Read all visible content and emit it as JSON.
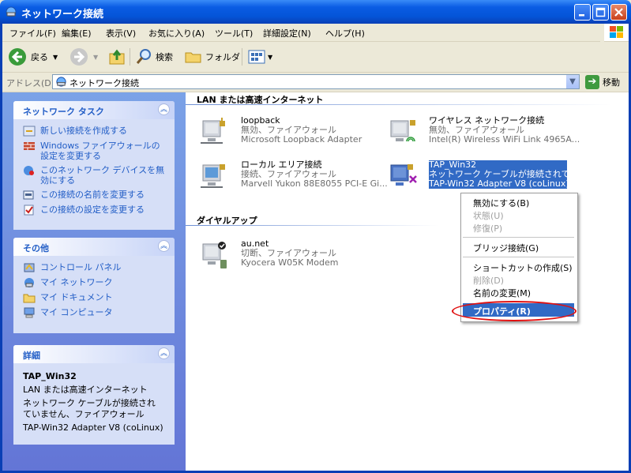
{
  "window": {
    "title": "ネットワーク接続"
  },
  "menu": [
    "ファイル(F)",
    "編集(E)",
    "表示(V)",
    "お気に入り(A)",
    "ツール(T)",
    "詳細設定(N)",
    "ヘルプ(H)"
  ],
  "toolbar": {
    "back": "戻る",
    "search": "検索",
    "folders": "フォルダ"
  },
  "address": {
    "label": "アドレス(D)",
    "value": "ネットワーク接続",
    "go": "移動"
  },
  "tasks": {
    "title": "ネットワーク タスク",
    "items": [
      "新しい接続を作成する",
      "Windows ファイアウォールの設定を変更する",
      "このネットワーク デバイスを無効にする",
      "この接続の名前を変更する",
      "この接続の設定を変更する"
    ]
  },
  "other": {
    "title": "その他",
    "items": [
      "コントロール パネル",
      "マイ ネットワーク",
      "マイ ドキュメント",
      "マイ コンピュータ"
    ]
  },
  "details": {
    "title": "詳細",
    "name": "TAP_Win32",
    "type": "LAN または高速インターネット",
    "status": "ネットワーク ケーブルが接続されていません、ファイアウォール",
    "adapter": "TAP-Win32 Adapter V8 (coLinux)"
  },
  "groups": {
    "lan": "LAN または高速インターネット",
    "dialup": "ダイヤルアップ"
  },
  "connections": {
    "loopback": {
      "name": "loopback",
      "status": "無効、ファイアウォール",
      "device": "Microsoft Loopback Adapter"
    },
    "wireless": {
      "name": "ワイヤレス ネットワーク接続",
      "status": "無効、ファイアウォール",
      "device": "Intel(R) Wireless WiFi Link 4965A..."
    },
    "local": {
      "name": "ローカル エリア接続",
      "status": "接続、ファイアウォール",
      "device": "Marvell Yukon 88E8055 PCI-E Gi..."
    },
    "tap": {
      "name": "TAP_Win32",
      "status": "ネットワーク ケーブルが接続されてい...",
      "device": "TAP-Win32 Adapter V8 (coLinux)"
    },
    "au": {
      "name": "au.net",
      "status": "切断、ファイアウォール",
      "device": "Kyocera W05K Modem"
    }
  },
  "context_menu": {
    "disable": "無効にする(B)",
    "status": "状態(U)",
    "repair": "修復(P)",
    "bridge": "ブリッジ接続(G)",
    "shortcut": "ショートカットの作成(S)",
    "delete": "削除(D)",
    "rename": "名前の変更(M)",
    "properties": "プロパティ(R)"
  },
  "colors": {
    "titlebar": "#0a5ce4",
    "selection": "#316ac5",
    "link": "#215dc6",
    "highlight_oval": "#e01010"
  }
}
